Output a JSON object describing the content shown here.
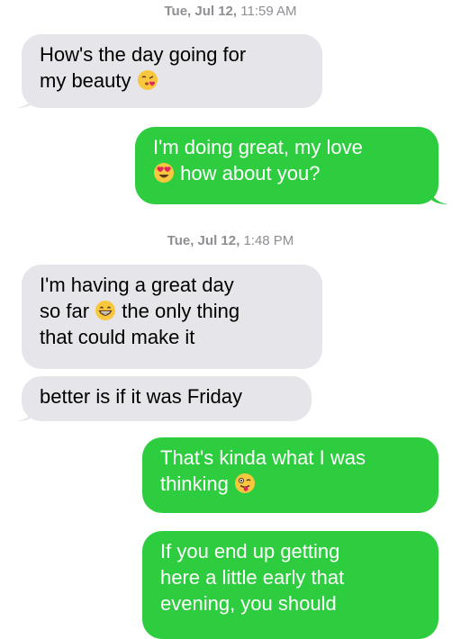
{
  "thread": {
    "timestamp1": {
      "day": "Tue, Jul 12,",
      "time": "11:59 AM"
    },
    "timestamp2": {
      "day": "Tue, Jul 12,",
      "time": "1:48 PM"
    },
    "msg1": {
      "line1": "How's the day going for",
      "line2": "my beauty",
      "emoji": "kissing-heart-emoji"
    },
    "msg2": {
      "line1": "I'm doing great, my love",
      "line2": "how about you?",
      "emoji": "heart-eyes-emoji"
    },
    "msg3": {
      "line1": "I'm having a great day",
      "line2a": "so far",
      "line2b": "the only thing",
      "line3": "that could make it",
      "emoji": "grinning-emoji"
    },
    "msg4": {
      "line1": "better is if it was Friday"
    },
    "msg5": {
      "line1": "That's kinda what I was",
      "line2": "thinking",
      "emoji": "winking-tongue-emoji"
    },
    "msg6": {
      "line1": "If you end up getting",
      "line2": "here a little early that",
      "line3": "evening, you should"
    }
  },
  "colors": {
    "incoming_bubble": "#e5e5ea",
    "outgoing_bubble": "#2dcd3f",
    "timestamp_text": "#8e8e93"
  }
}
